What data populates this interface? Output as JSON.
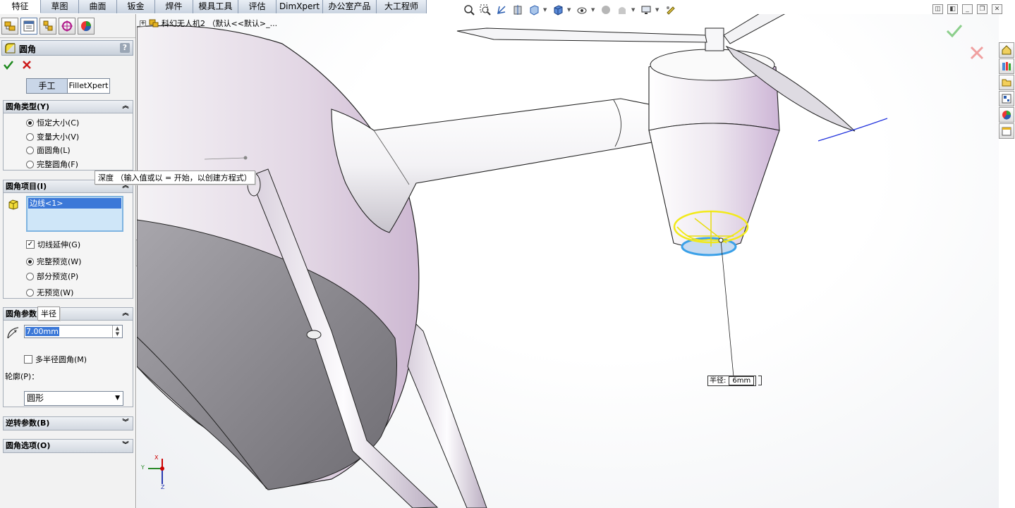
{
  "cm_tabs": [
    "特征",
    "草图",
    "曲面",
    "钣金",
    "焊件",
    "模具工具",
    "评估",
    "DimXpert",
    "办公室产品",
    "大工程师"
  ],
  "active_tab_index": 0,
  "pm": {
    "title": "圆角",
    "help": "?",
    "ok_color": "#1f8a1f",
    "cancel_color": "#cc1a1a",
    "mode_manual": "手工",
    "mode_xpert": "FilletXpert",
    "fillet_type": {
      "header": "圆角类型(Y)",
      "options": [
        "恒定大小(C)",
        "变量大小(V)",
        "面圆角(L)",
        "完整圆角(F)"
      ],
      "selected": 0
    },
    "fillet_items": {
      "header": "圆角项目(I)",
      "selection": "边线<1>",
      "tangent": "切线延伸(G)",
      "tangent_checked": true,
      "preview_options": [
        "完整预览(W)",
        "部分预览(P)",
        "无预览(W)"
      ],
      "preview_selected": 0
    },
    "fillet_params": {
      "header": "圆角参数",
      "radius_value": "7.00mm",
      "multi_radius": "多半径圆角(M)",
      "profile_label": "轮廓(P)：",
      "profile_value": "圆形"
    },
    "reverse_params": "逆转参数(B)",
    "fillet_options": "圆角选项(O)"
  },
  "tooltips": {
    "depth": "深度 （输入值或以 = 开始，以创建方程式）",
    "radius": "半径"
  },
  "tree_flyout": "科幻无人机2 （默认<<默认>_...",
  "dimension_label": "半径:",
  "dimension_value": "6mm",
  "triad": {
    "x": "X",
    "y": "Y",
    "z": "Z"
  },
  "colors": {
    "selection_yellow": "#f2ea1a",
    "edge_blue": "#3aa0e8",
    "accent": "#2a5db0"
  }
}
